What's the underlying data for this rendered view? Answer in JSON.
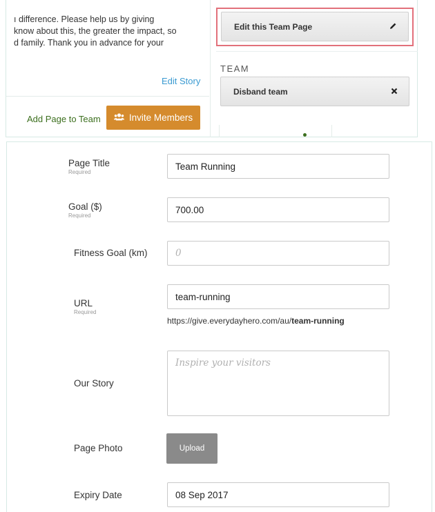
{
  "top": {
    "story_text": "ı difference. Please help us by giving\n know about this, the greater the impact, so\nd family. Thank you in advance for your",
    "edit_story": "Edit Story",
    "add_page_to_team": "Add Page to Team",
    "invite_members": "Invite Members",
    "edit_team_page": "Edit this Team Page",
    "team_heading": "TEAM",
    "disband_team": "Disband team"
  },
  "form": {
    "page_title": {
      "label": "Page Title",
      "required": "Required",
      "value": "Team Running"
    },
    "goal": {
      "label": "Goal ($)",
      "required": "Required",
      "value": "700.00"
    },
    "fitness_goal": {
      "label": "Fitness Goal (km)",
      "placeholder": "0"
    },
    "url": {
      "label": "URL",
      "required": "Required",
      "value": "team-running",
      "hint_prefix": "https://give.everydayhero.com/au/",
      "hint_slug": "team-running"
    },
    "our_story": {
      "label": "Our Story",
      "placeholder": "Inspire your visitors"
    },
    "page_photo": {
      "label": "Page Photo",
      "upload": "Upload"
    },
    "expiry_date": {
      "label": "Expiry Date",
      "value": "08 Sep 2017"
    }
  },
  "colors": {
    "accent_orange": "#d58b2d",
    "link_blue": "#3a9ad1",
    "link_green": "#3c6f1e",
    "highlight_red": "#e2707a"
  },
  "icons": {
    "invite": "users-icon",
    "edit": "pencil-icon",
    "disband": "close-icon"
  }
}
